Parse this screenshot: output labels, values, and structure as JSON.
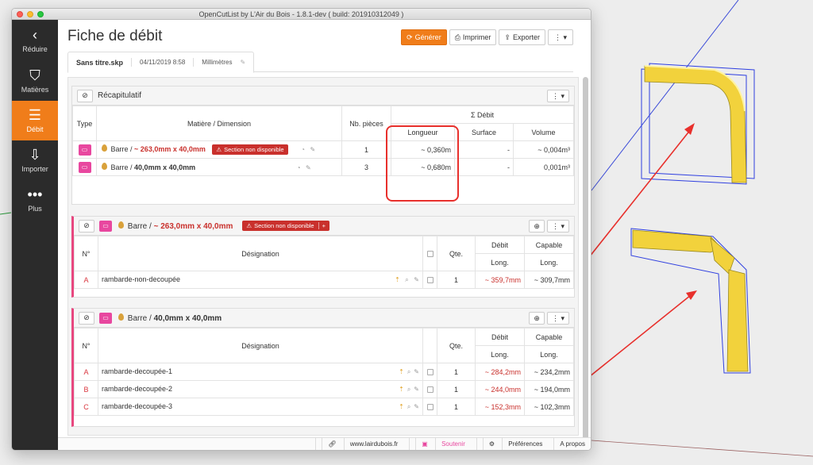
{
  "window": {
    "title": "OpenCutList by L'Air du Bois - 1.8.1-dev ( build: 201910312049 )"
  },
  "sidebar": {
    "items": [
      {
        "label": "Réduire",
        "icon": "chevron-left-icon"
      },
      {
        "label": "Matières",
        "icon": "paint-bucket-icon"
      },
      {
        "label": "Débit",
        "icon": "list-icon"
      },
      {
        "label": "Importer",
        "icon": "import-icon"
      },
      {
        "label": "Plus",
        "icon": "more-icon"
      }
    ]
  },
  "header": {
    "title": "Fiche de débit",
    "generate": "Générer",
    "print": "Imprimer",
    "export": "Exporter"
  },
  "tab": {
    "file": "Sans titre.skp",
    "date": "04/11/2019 8:58",
    "unit": "Millimètres"
  },
  "summary": {
    "title": "Récapitulatif",
    "headers": {
      "type": "Type",
      "material": "Matière / Dimension",
      "count": "Nb. pièces",
      "debit": "Σ Débit",
      "length": "Longueur",
      "surface": "Surface",
      "volume": "Volume"
    },
    "rows": [
      {
        "material": "Barre",
        "dimension": "~ 263,0mm x 40,0mm",
        "badge": "Section non disponible",
        "count": "1",
        "length": "~ 0,360m",
        "surface": "-",
        "volume": "~ 0,004m³"
      },
      {
        "material": "Barre",
        "dimension": "40,0mm x 40,0mm",
        "count": "3",
        "length": "~ 0,680m",
        "surface": "-",
        "volume": "0,001m³"
      }
    ]
  },
  "groups": [
    {
      "material": "Barre",
      "dimension": "~ 263,0mm x 40,0mm",
      "badge": "Section non disponible",
      "headers": {
        "no": "N°",
        "designation": "Désignation",
        "qty": "Qte.",
        "debit": "Débit",
        "capable": "Capable",
        "long": "Long."
      },
      "rows": [
        {
          "no": "A",
          "name": "rambarde-non-decoupée",
          "qty": "1",
          "debit": "~ 359,7mm",
          "capable": "~ 309,7mm"
        }
      ]
    },
    {
      "material": "Barre",
      "dimension": "40,0mm x 40,0mm",
      "headers": {
        "no": "N°",
        "designation": "Désignation",
        "qty": "Qte.",
        "debit": "Débit",
        "capable": "Capable",
        "long": "Long."
      },
      "rows": [
        {
          "no": "A",
          "name": "rambarde-decoupée-1",
          "qty": "1",
          "debit": "~ 284,2mm",
          "capable": "~ 234,2mm"
        },
        {
          "no": "B",
          "name": "rambarde-decoupée-2",
          "qty": "1",
          "debit": "~ 244,0mm",
          "capable": "~ 194,0mm"
        },
        {
          "no": "C",
          "name": "rambarde-decoupée-3",
          "qty": "1",
          "debit": "~ 152,3mm",
          "capable": "~ 102,3mm"
        }
      ]
    }
  ],
  "footer": {
    "site": "www.lairdubois.fr",
    "support": "Soutenir",
    "prefs": "Préférences",
    "about": "A propos"
  },
  "colors": {
    "accent": "#f07d1a",
    "material": "#e8479f",
    "danger": "#c9302c",
    "wood": "#f2d23c"
  }
}
